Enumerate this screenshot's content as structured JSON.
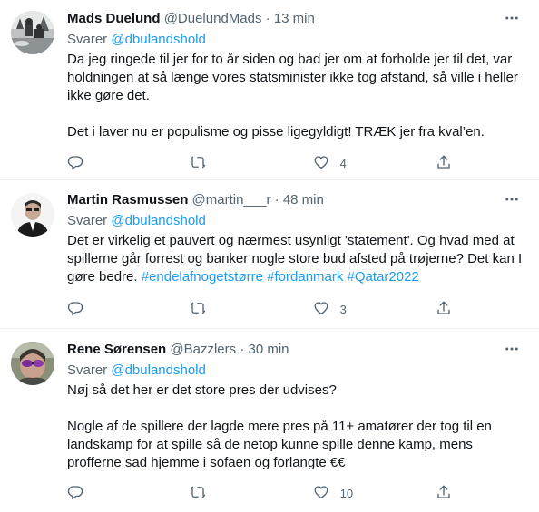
{
  "tweets": [
    {
      "name": "Mads Duelund",
      "handle": "@DuelundMads",
      "separator": "·",
      "time": "13 min",
      "reply_prefix": "Svarer",
      "reply_to": "@dbulandshold",
      "paragraphs": [
        "Da jeg ringede til jer for to år siden og bad jer om at forholde jer til det, var holdningen at så længe vores statsminister ikke tog afstand, så ville i heller ikke gøre det.",
        "Det i laver nu er populisme og pisse ligegyldigt! TRÆK jer fra kval’en."
      ],
      "reply_count": "",
      "retweet_count": "",
      "like_count": "4"
    },
    {
      "name": "Martin Rasmussen",
      "handle": "@martin___r",
      "separator": "·",
      "time": "48 min",
      "reply_prefix": "Svarer",
      "reply_to": "@dbulandshold",
      "text": "Det er virkelig et pauvert og nærmest usynligt 'statement'. Og hvad med at spillerne går forrest og banker nogle store bud afsted på trøjerne? Det kan I gøre bedre. ",
      "hashtags": [
        "#endelafnogetstørre",
        "#fordanmark",
        "#Qatar2022"
      ],
      "reply_count": "",
      "retweet_count": "",
      "like_count": "3"
    },
    {
      "name": "Rene Sørensen",
      "handle": "@Bazzlers",
      "separator": "·",
      "time": "30 min",
      "reply_prefix": "Svarer",
      "reply_to": "@dbulandshold",
      "paragraphs": [
        "Nøj så det her er det store pres der udvises?",
        "Nogle af de spillere der lagde mere pres på 11+ amatører der tog til en landskamp for at spille så de netop kunne spille denne kamp, mens profferne sad hjemme i sofaen og forlangte €€"
      ],
      "reply_count": "",
      "retweet_count": "",
      "like_count": "10"
    }
  ],
  "colors": {
    "link": "#1d9bf0",
    "secondary": "#536471",
    "text": "#0f1419",
    "divider": "#eff3f4"
  },
  "icons": [
    "more-icon",
    "reply-icon",
    "retweet-icon",
    "like-icon",
    "share-icon"
  ]
}
